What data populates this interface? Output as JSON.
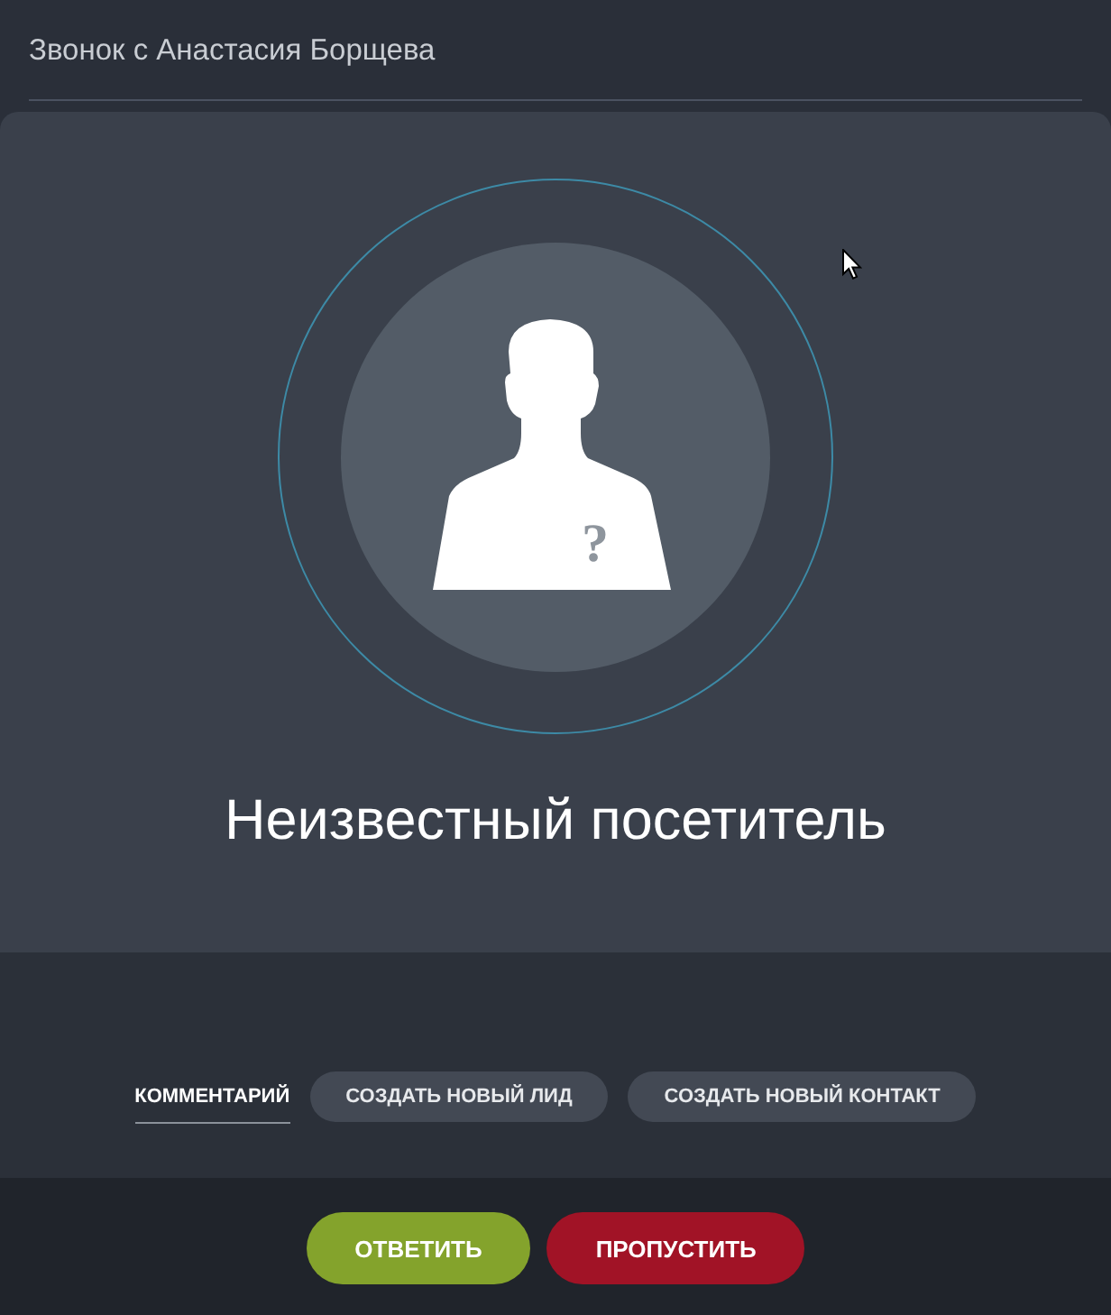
{
  "call_header": {
    "title": "Звонок с Анастасия Борщева"
  },
  "caller": {
    "mark": "?",
    "name": "Неизвестный посетитель"
  },
  "tabs": [
    {
      "label": "КОММЕНТАРИЙ",
      "selected": true
    },
    {
      "label": "СОЗДАТЬ НОВЫЙ ЛИД",
      "selected": false
    },
    {
      "label": "СОЗДАТЬ НОВЫЙ КОНТАКТ",
      "selected": false
    }
  ],
  "actions": [
    {
      "label": "ОТВЕТИТЬ",
      "kind": "answer"
    },
    {
      "label": "ПРОПУСТИТЬ",
      "kind": "skip"
    }
  ]
}
